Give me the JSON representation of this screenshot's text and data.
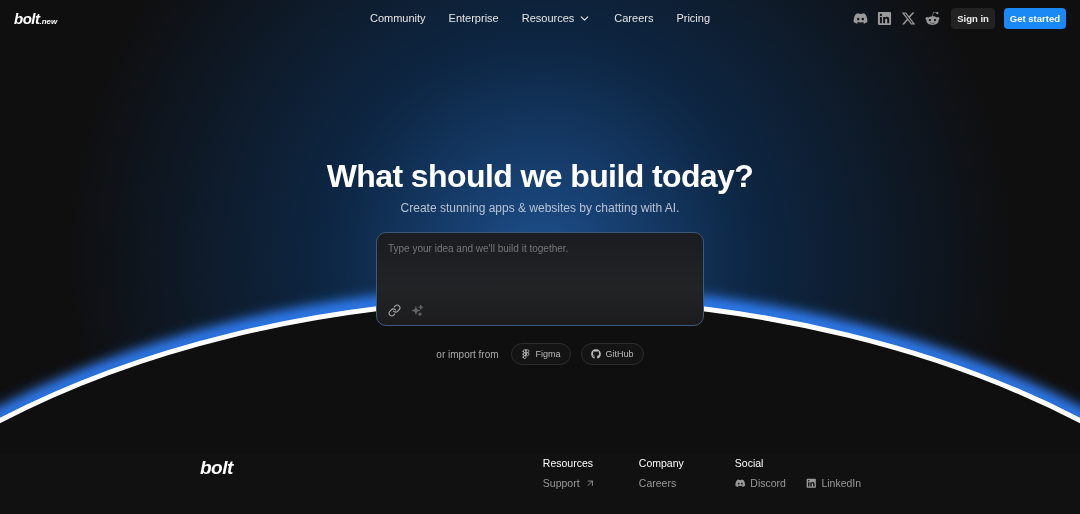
{
  "header": {
    "logo": {
      "word": "bolt",
      "suffix": ".new"
    },
    "nav": [
      {
        "label": "Community",
        "dropdown": false
      },
      {
        "label": "Enterprise",
        "dropdown": false
      },
      {
        "label": "Resources",
        "dropdown": true
      },
      {
        "label": "Careers",
        "dropdown": false
      },
      {
        "label": "Pricing",
        "dropdown": false
      }
    ],
    "social": [
      {
        "kind": "discord"
      },
      {
        "kind": "linkedin"
      },
      {
        "kind": "x"
      },
      {
        "kind": "reddit"
      }
    ],
    "sign_in": "Sign in",
    "get_started": "Get started"
  },
  "hero": {
    "title": "What should we build today?",
    "subtitle": "Create stunning apps & websites by chatting with AI.",
    "prompt": {
      "placeholder": "Type your idea and we'll build it together."
    },
    "import_label": "or import from",
    "imports": [
      {
        "kind": "figma",
        "label": "Figma"
      },
      {
        "kind": "github",
        "label": "GitHub"
      }
    ]
  },
  "footer": {
    "logo": "bolt",
    "columns": [
      {
        "title": "Resources",
        "links": [
          {
            "label": "Support",
            "external": true,
            "kind": "text"
          }
        ]
      },
      {
        "title": "Company",
        "links": [
          {
            "label": "Careers",
            "external": false,
            "kind": "text"
          }
        ]
      },
      {
        "title": "Social",
        "links": [
          {
            "label": "Discord",
            "external": false,
            "kind": "discord"
          },
          {
            "label": "LinkedIn",
            "external": false,
            "kind": "linkedin"
          }
        ]
      }
    ]
  }
}
